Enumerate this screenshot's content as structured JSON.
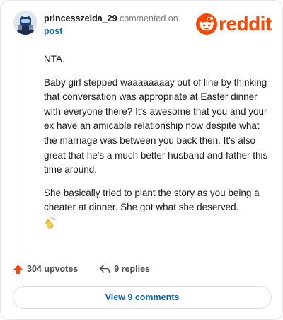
{
  "header": {
    "username": "princesszelda_29",
    "action_text": "commented on",
    "target": "post",
    "logo_text": "reddit"
  },
  "comment": {
    "paragraphs": [
      "NTA.",
      "Baby girl stepped waaaaaaaay out of line by thinking that conversation was appropriate at Easter dinner with everyone there? It's awesome that you and your ex have an amicable relationship now despite what the marriage was between you back then. It's also great that he's a much better husband and father this time around.",
      "She basically tried to plant the story as you being a cheater at dinner. She got what she deserved."
    ],
    "emoji": "clapping-hands"
  },
  "footer": {
    "upvotes": "304 upvotes",
    "replies": "9 replies",
    "view_button": "View 9 comments"
  },
  "colors": {
    "brand": "#ff4500",
    "link": "#0a66c2",
    "meta": "#7c7c7c"
  }
}
